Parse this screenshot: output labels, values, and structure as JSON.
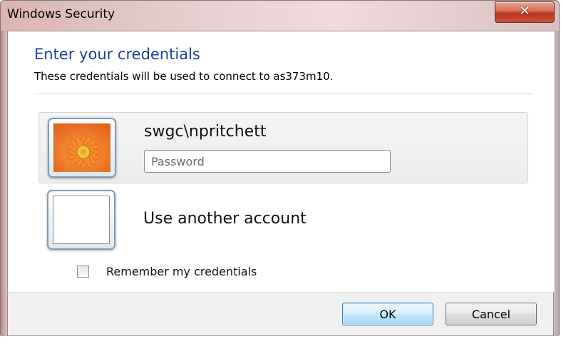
{
  "window": {
    "title": "Windows Security",
    "close_label": "✕"
  },
  "header": {
    "heading": "Enter your credentials",
    "subtext": "These credentials will be used to connect to as373m10."
  },
  "selected_account": {
    "username": "swgc\\npritchett",
    "password_placeholder": "Password",
    "password_value": ""
  },
  "other_account": {
    "label": "Use another account"
  },
  "remember": {
    "label": "Remember my credentials",
    "checked": false
  },
  "buttons": {
    "ok_label": "OK",
    "cancel_label": "Cancel"
  },
  "icons": {
    "user_tile": "flower-user-tile-icon",
    "blank_tile": "blank-user-tile-icon",
    "close": "close-icon"
  },
  "colors": {
    "heading": "#1e3f9e",
    "ok_border": "#3c7fb1",
    "close_button": "#c8503a"
  }
}
